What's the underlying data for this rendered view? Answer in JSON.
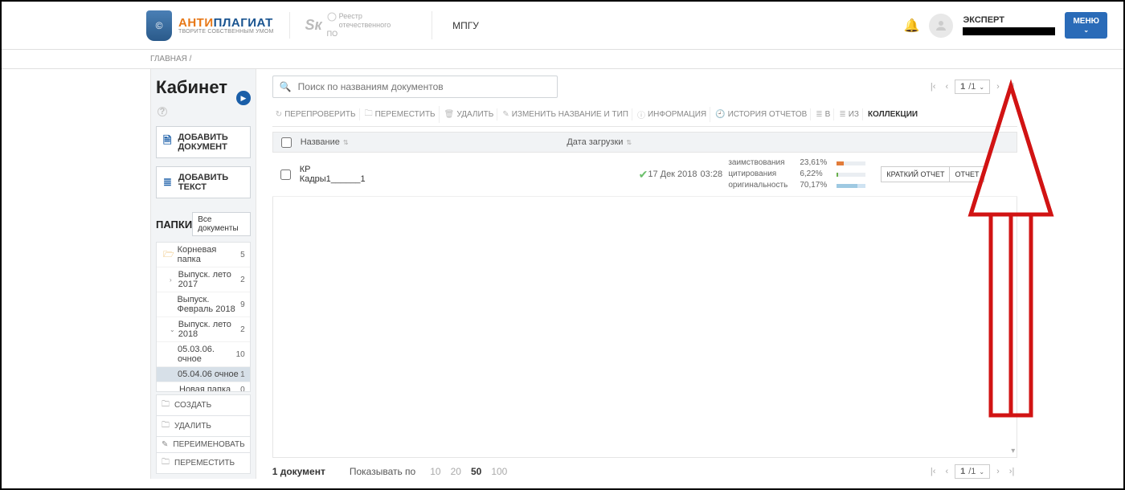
{
  "header": {
    "logo_brand1": "АНТИ",
    "logo_brand2": "ПЛАГИАТ",
    "logo_tagline": "ТВОРИТЕ СОБСТВЕННЫМ УМОМ",
    "cert_line1": "Реестр",
    "cert_line2": "отечественного ПО",
    "org": "МПГУ",
    "role": "ЭКСПЕРТ",
    "menu_label": "МЕНЮ"
  },
  "breadcrumb": {
    "home": "ГЛАВНАЯ /"
  },
  "sidebar": {
    "title": "Кабинет",
    "add_doc": "ДОБАВИТЬ ДОКУМЕНТ",
    "add_text": "ДОБАВИТЬ ТЕКСТ",
    "folders_title": "ПАПКИ",
    "all_docs": "Все документы",
    "tree": [
      {
        "label": "Корневая папка",
        "count": 5,
        "root": true
      },
      {
        "label": "Выпуск. лето 2017",
        "count": 2,
        "indent": 1,
        "chev": "›"
      },
      {
        "label": "Выпуск. Февраль 2018",
        "count": 9,
        "indent": 1
      },
      {
        "label": "Выпуск. лето 2018",
        "count": 2,
        "indent": 1,
        "chev": "⌄"
      },
      {
        "label": "05.03.06. очное",
        "count": 10,
        "indent": 2
      },
      {
        "label": "05.04.06 очное",
        "count": 1,
        "indent": 2,
        "active": true
      },
      {
        "label": "Новая папка",
        "count": 0,
        "indent": 1
      }
    ],
    "actions": {
      "create": "СОЗДАТЬ",
      "delete": "УДАЛИТЬ",
      "rename": "ПЕРЕИМЕНОВАТЬ",
      "move": "ПЕРЕМЕСТИТЬ"
    }
  },
  "main": {
    "search_placeholder": "Поиск по названиям документов",
    "page_now": "1",
    "page_total": "/1",
    "toolbar": {
      "recheck": "ПЕРЕПРОВЕРИТЬ",
      "move": "ПЕРЕМЕСТИТЬ",
      "delete": "УДАЛИТЬ",
      "rename": "ИЗМЕНИТЬ НАЗВАНИЕ И ТИП",
      "info": "ИНФОРМАЦИЯ",
      "history": "ИСТОРИЯ ОТЧЕТОВ",
      "to": "В",
      "from": "ИЗ",
      "collections": "КОЛЛЕКЦИИ"
    },
    "columns": {
      "name": "Название",
      "date": "Дата загрузки"
    },
    "row": {
      "name": "КР Кадры1______1",
      "date_line1": "17 Дек 2018",
      "date_line2": "03:28",
      "borrow_label": "заимствования",
      "borrow_val": "23,61%",
      "cite_label": "цитирования",
      "cite_val": "6,22%",
      "orig_label": "оригинальность",
      "orig_val": "70,17%",
      "btn_short": "КРАТКИЙ ОТЧЕТ",
      "btn_report": "ОТЧЕТ"
    },
    "footer": {
      "count": "1 документ",
      "showby": "Показывать по",
      "pp": [
        "10",
        "20",
        "50",
        "100"
      ],
      "pp_active": "50"
    }
  }
}
